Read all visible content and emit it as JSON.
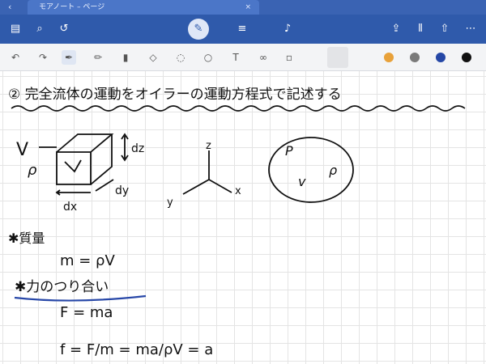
{
  "tab": {
    "title": "モアノート – ページ",
    "close_glyph": "×"
  },
  "app": {
    "colors": {
      "tab_bar": "#3a63b3",
      "app_bar": "#2f5aab",
      "toolbar": "#f3f4f6",
      "ink": "#111111",
      "underline": "#2848a8"
    }
  },
  "appbar_icons": {
    "sidebar": "sidebar-icon",
    "search": "search-icon",
    "undo": "undo-icon",
    "pen_mode": "pen-mode-icon",
    "page_add": "page-add-icon",
    "mic": "mic-icon",
    "share": "share-icon",
    "columns": "columns-icon",
    "export": "export-icon",
    "more": "more-icon"
  },
  "tools": {
    "undo": "undo-icon",
    "redo": "redo-icon",
    "pen": "pen-icon",
    "pencil": "pencil-icon",
    "highlighter": "highlighter-icon",
    "eraser": "eraser-icon",
    "lasso": "lasso-icon",
    "shapes": "shapes-icon",
    "text": "text-icon",
    "link": "link-icon",
    "image": "image-icon"
  },
  "colors": [
    "#e8a13a",
    "#7a7a7a",
    "#2547a6",
    "#111111"
  ],
  "note": {
    "heading": "② 完全流体の運動をオイラーの運動方程式で記述する",
    "cube_V": "V",
    "cube_rho": "ρ",
    "dz": "dz",
    "dy": "dy",
    "dx": "dx",
    "axis_z": "z",
    "axis_x": "x",
    "axis_y": "y",
    "ellipse_P": "P",
    "ellipse_rho": "ρ",
    "ellipse_v": "v",
    "mass_label": "✱質量",
    "mass_eq": "m = ρV",
    "balance_label": "✱力のつり合い",
    "force_eq": "F = ma",
    "accel_eq": "f = F/m = ma/ρV = a"
  }
}
